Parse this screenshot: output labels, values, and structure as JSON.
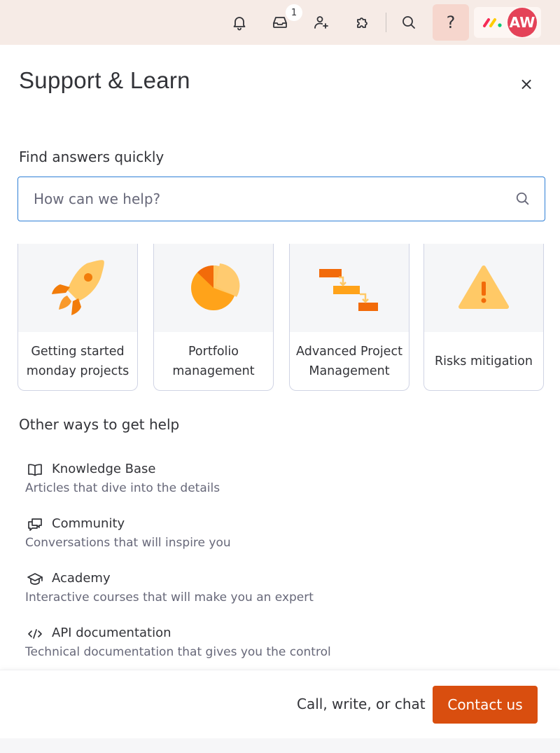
{
  "topbar": {
    "inbox_badge": "1",
    "help_label": "?",
    "avatar_initials": "AW"
  },
  "panel": {
    "title": "Support & Learn",
    "close_label": "×"
  },
  "search": {
    "label": "Find answers quickly",
    "placeholder": "How can we help?"
  },
  "cards": [
    {
      "label": "Getting started monday projects",
      "icon": "rocket-icon"
    },
    {
      "label": "Portfolio management",
      "icon": "pie-chart-icon"
    },
    {
      "label": "Advanced Project Management",
      "icon": "gantt-icon"
    },
    {
      "label": "Risks mitigation",
      "icon": "warning-icon"
    }
  ],
  "other_help": {
    "title": "Other ways to get help",
    "items": [
      {
        "title": "Knowledge Base",
        "description": "Articles that dive into the details",
        "icon": "book-icon"
      },
      {
        "title": "Community",
        "description": "Conversations that will inspire you",
        "icon": "chat-bubbles-icon"
      },
      {
        "title": "Academy",
        "description": "Interactive courses that will make you an expert",
        "icon": "graduation-cap-icon"
      },
      {
        "title": "API documentation",
        "description": "Technical documentation that gives you the control",
        "icon": "code-icon"
      }
    ]
  },
  "footer": {
    "text": "Call, write, or chat",
    "contact_label": "Contact us"
  },
  "colors": {
    "accent": "#d94e0f",
    "topbar_bg": "#f6ebe6",
    "avatar_bg": "#e44258",
    "focus_border": "#2e7fd6"
  }
}
